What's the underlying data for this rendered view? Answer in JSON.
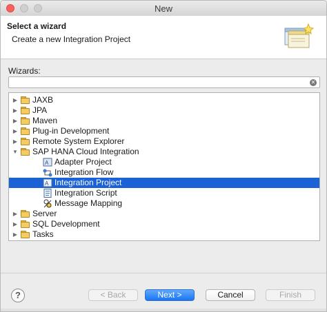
{
  "window": {
    "title": "New"
  },
  "header": {
    "title": "Select a wizard",
    "subtitle": "Create a new Integration Project"
  },
  "filter": {
    "label": "Wizards:",
    "value": ""
  },
  "tree": [
    {
      "label": "JAXB",
      "icon": "folder-icon",
      "level": 0,
      "expanded": false,
      "selected": false
    },
    {
      "label": "JPA",
      "icon": "folder-icon",
      "level": 0,
      "expanded": false,
      "selected": false
    },
    {
      "label": "Maven",
      "icon": "folder-icon",
      "level": 0,
      "expanded": false,
      "selected": false
    },
    {
      "label": "Plug-in Development",
      "icon": "folder-icon",
      "level": 0,
      "expanded": false,
      "selected": false
    },
    {
      "label": "Remote System Explorer",
      "icon": "folder-icon",
      "level": 0,
      "expanded": false,
      "selected": false
    },
    {
      "label": "SAP HANA Cloud Integration",
      "icon": "folder-icon",
      "level": 0,
      "expanded": true,
      "selected": false
    },
    {
      "label": "Adapter Project",
      "icon": "adapter-project-icon",
      "level": 1,
      "selected": false
    },
    {
      "label": "Integration Flow",
      "icon": "integration-flow-icon",
      "level": 1,
      "selected": false
    },
    {
      "label": "Integration Project",
      "icon": "integration-project-icon",
      "level": 1,
      "selected": true
    },
    {
      "label": "Integration Script",
      "icon": "integration-script-icon",
      "level": 1,
      "selected": false
    },
    {
      "label": "Message Mapping",
      "icon": "message-mapping-icon",
      "level": 1,
      "selected": false
    },
    {
      "label": "Server",
      "icon": "folder-icon",
      "level": 0,
      "expanded": false,
      "selected": false
    },
    {
      "label": "SQL Development",
      "icon": "folder-icon",
      "level": 0,
      "expanded": false,
      "selected": false
    },
    {
      "label": "Tasks",
      "icon": "folder-icon",
      "level": 0,
      "expanded": false,
      "selected": false
    }
  ],
  "buttons": {
    "back": "< Back",
    "next": "Next >",
    "cancel": "Cancel",
    "finish": "Finish"
  },
  "colors": {
    "selection": "#1a62d6",
    "primary_button": "#1b75f2",
    "close_light": "#fc605c"
  }
}
